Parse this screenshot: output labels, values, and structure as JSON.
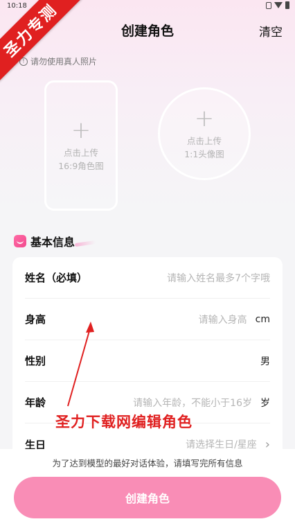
{
  "status_bar": {
    "time": "10:18"
  },
  "banner": {
    "text": "圣力专测"
  },
  "header": {
    "title": "创建角色",
    "clear_label": "清空"
  },
  "notice": {
    "text": "请勿使用真人照片"
  },
  "uploads": {
    "portrait": {
      "line1": "点击上传",
      "line2": "16:9角色图"
    },
    "avatar": {
      "line1": "点击上传",
      "line2": "1:1头像图"
    }
  },
  "section": {
    "title": "基本信息"
  },
  "form": {
    "name": {
      "label": "姓名（必填）",
      "placeholder": "请输入姓名最多7个字哦"
    },
    "height": {
      "label": "身高",
      "placeholder": "请输入身高",
      "unit": "cm"
    },
    "gender": {
      "label": "性别",
      "value": "男"
    },
    "age": {
      "label": "年龄",
      "placeholder": "请输入年龄，不能小于16岁",
      "unit": "岁"
    },
    "birthday": {
      "label": "生日",
      "placeholder": "请选择生日/星座"
    }
  },
  "watermark": {
    "text": "圣力下载网编辑角色"
  },
  "footer": {
    "hint": "为了达到模型的最好对话体验，请填写完所有信息",
    "create_label": "创建角色"
  },
  "colors": {
    "accent": "#f98db6",
    "annotation_red": "#e02020"
  }
}
